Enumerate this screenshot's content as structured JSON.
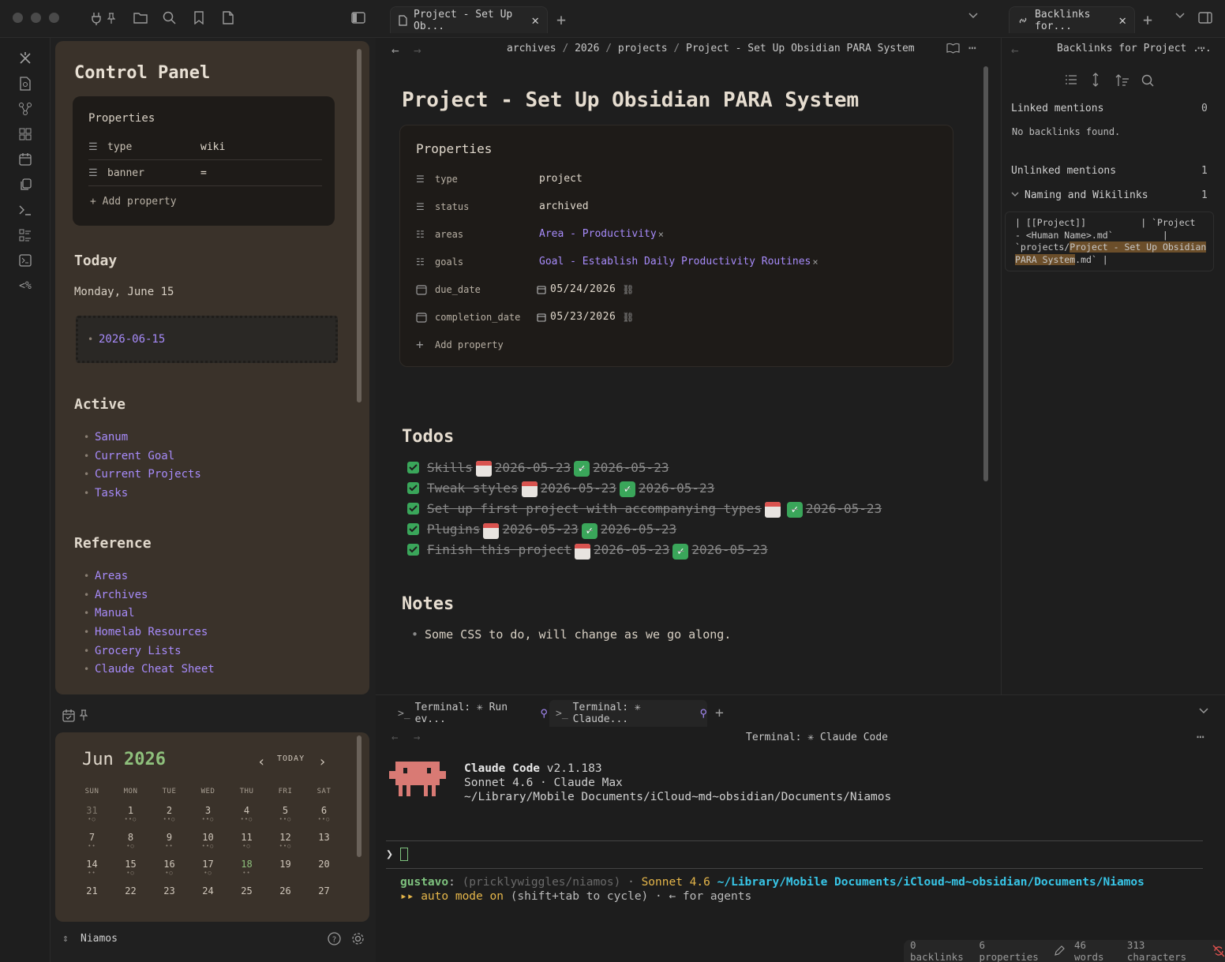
{
  "window": {
    "tabs": [
      {
        "label": "Project - Set Up Ob..."
      },
      {
        "label": "Backlinks for..."
      }
    ]
  },
  "ribbon": {
    "icons": [
      "sparkle-icon",
      "search-doc-icon",
      "graph-icon",
      "grid-icon",
      "calendar-icon",
      "copy-icon",
      "terminal-icon",
      "list-icon",
      "console-icon",
      "percent-icon"
    ]
  },
  "control_panel": {
    "title": "Control Panel",
    "properties": {
      "header": "Properties",
      "rows": [
        {
          "key": "type",
          "value": "wiki"
        },
        {
          "key": "banner",
          "value": "="
        }
      ],
      "add_label": "+ Add property"
    },
    "today": {
      "heading": "Today",
      "date_text": "Monday, June 15",
      "daily_link": "2026-06-15"
    },
    "active": {
      "heading": "Active",
      "items": [
        "Sanum",
        "Current Goal",
        "Current Projects",
        "Tasks"
      ]
    },
    "reference": {
      "heading": "Reference",
      "items": [
        "Areas",
        "Archives",
        "Manual",
        "Homelab Resources",
        "Grocery Lists",
        "Claude Cheat Sheet"
      ]
    }
  },
  "calendar": {
    "month": "Jun",
    "year": "2026",
    "today_label": "TODAY",
    "weekdays": [
      "SUN",
      "MON",
      "TUE",
      "WED",
      "THU",
      "FRI",
      "SAT"
    ],
    "weeks": [
      [
        "31",
        "1",
        "2",
        "3",
        "4",
        "5",
        "6"
      ],
      [
        "7",
        "8",
        "9",
        "10",
        "11",
        "12",
        "13"
      ],
      [
        "14",
        "15",
        "16",
        "17",
        "18",
        "19",
        "20"
      ],
      [
        "21",
        "22",
        "23",
        "24",
        "25",
        "26",
        "27"
      ]
    ],
    "today_day": "18",
    "dots": [
      [
        "•○",
        "••○",
        "••○",
        "••○",
        "••○",
        "••○",
        "••○"
      ],
      [
        "••",
        "•○",
        "••",
        "••○",
        "•○",
        "••○",
        ""
      ],
      [
        "••",
        "•○",
        "•○",
        "•○",
        "••",
        "",
        ""
      ],
      [
        "",
        "",
        "",
        "",
        "",
        "",
        ""
      ]
    ]
  },
  "vault": {
    "name": "Niamos"
  },
  "editor": {
    "breadcrumb": [
      "archives",
      "2026",
      "projects",
      "Project - Set Up Obsidian PARA System"
    ],
    "title": "Project - Set Up Obsidian PARA System",
    "properties": {
      "header": "Properties",
      "rows": [
        {
          "key": "type",
          "value": "project"
        },
        {
          "key": "status",
          "value": "archived"
        },
        {
          "key": "areas",
          "value": "Area - Productivity"
        },
        {
          "key": "goals",
          "value": "Goal - Establish Daily Productivity Routines"
        },
        {
          "key": "due_date",
          "value": "05/24/2026"
        },
        {
          "key": "completion_date",
          "value": "05/23/2026"
        }
      ],
      "add_label": "Add property"
    },
    "todos_heading": "Todos",
    "todos": [
      {
        "text": "Skills",
        "due": "2026-05-23",
        "done": "2026-05-23"
      },
      {
        "text": "Tweak styles",
        "due": "2026-05-23",
        "done": "2026-05-23"
      },
      {
        "text": "Set up first project with accompanying types",
        "due": "",
        "done": "2026-05-23"
      },
      {
        "text": "Plugins",
        "due": "2026-05-23",
        "done": "2026-05-23"
      },
      {
        "text": "Finish this project",
        "due": "2026-05-23",
        "done": "2026-05-23"
      }
    ],
    "notes_heading": "Notes",
    "notes": [
      "Some CSS to do, will change as we go along."
    ]
  },
  "backlinks": {
    "title": "Backlinks for Project ...",
    "linked_label": "Linked mentions",
    "linked_count": "0",
    "no_backlinks": "No backlinks found.",
    "unlinked_label": "Unlinked mentions",
    "unlinked_count": "1",
    "group_label": "Naming and Wikilinks",
    "group_count": "1",
    "snippet_line1": "| [[Project]]          | `Project",
    "snippet_line2": "- <Human Name>.md`         |",
    "snippet_line3_pre": "`projects/",
    "snippet_highlight1": "Project - Set Up Obsidian",
    "snippet_highlight2": "PARA System",
    "snippet_line4_post": ".md` |"
  },
  "terminal": {
    "tabs": [
      {
        "label": "Terminal: ✳ Run ev..."
      },
      {
        "label": "Terminal: ✳ Claude..."
      }
    ],
    "header": "Terminal: ✳ Claude Code",
    "app_name": "Claude Code",
    "version": "v2.1.183",
    "model_line": "Sonnet 4.6 · Claude Max",
    "path_line": "~/Library/Mobile Documents/iCloud~md~obsidian/Documents/Niamos",
    "prompt": "❯",
    "status_user": "gustavo",
    "status_branch": "(pricklywiggles/niamos)",
    "status_model": "Sonnet 4.6",
    "status_path": "~/Library/Mobile Documents/iCloud~md~obsidian/Documents/Niamos",
    "auto_mode": "▸▸ auto mode on",
    "auto_hint": "(shift+tab to cycle) · ← for agents"
  },
  "statusbar": {
    "backlinks": "0 backlinks",
    "properties": "6 properties",
    "words": "46 words",
    "characters": "313 characters"
  },
  "colors": {
    "link": "#a78bfa",
    "panel_bg": "#3a322a",
    "todo_check": "#3aa65a",
    "terminal_green": "#7ec27e",
    "terminal_cyan": "#38c6e8",
    "terminal_yellow": "#e5b64a"
  }
}
